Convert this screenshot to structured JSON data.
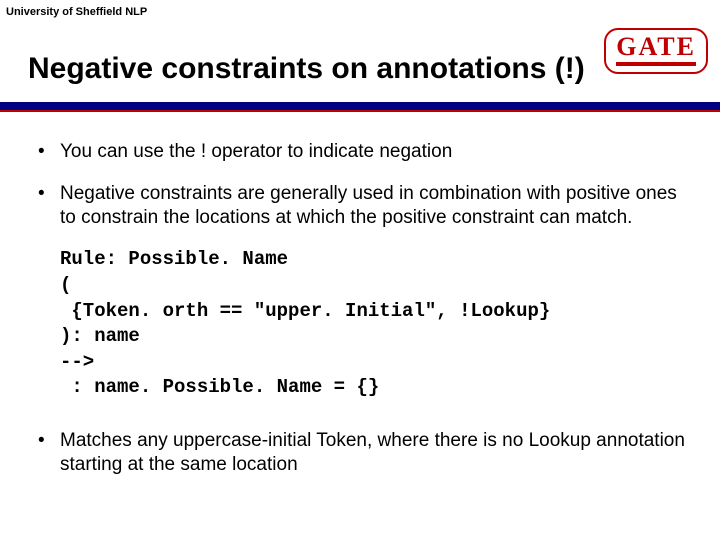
{
  "header": {
    "label": "University of Sheffield NLP"
  },
  "logo": {
    "text": "GATE"
  },
  "title": "Negative constraints on annotations (!)",
  "bullets": {
    "b1": "You can use the ! operator to  indicate negation",
    "b2": "Negative constraints are generally used in combination with positive ones to constrain the locations at which the positive constraint can match.",
    "b3": "Matches any uppercase-initial Token, where there is no Lookup annotation starting at the same location"
  },
  "code": {
    "l1": "Rule: Possible. Name",
    "l2": "(",
    "l3": " {Token. orth == \"upper. Initial\", !Lookup}",
    "l4": "): name",
    "l5": "-->",
    "l6": " : name. Possible. Name = {}"
  }
}
